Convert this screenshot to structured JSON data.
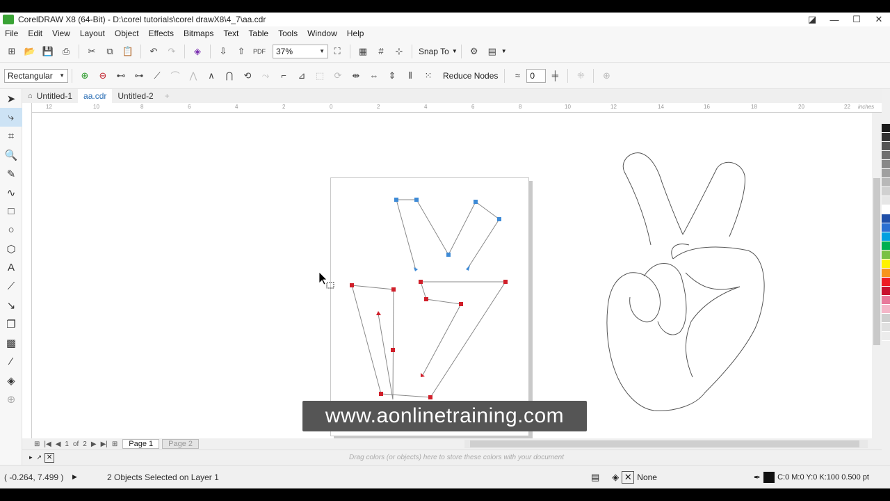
{
  "window": {
    "title": "CorelDRAW X8 (64-Bit) - D:\\corel tutorials\\corel drawX8\\4_7\\aa.cdr",
    "controls": [
      "◪",
      "—",
      "☐",
      "✕"
    ]
  },
  "menu": [
    "File",
    "Edit",
    "View",
    "Layout",
    "Object",
    "Effects",
    "Bitmaps",
    "Text",
    "Table",
    "Tools",
    "Window",
    "Help"
  ],
  "standard_toolbar": {
    "zoom_value": "37%",
    "snap_label": "Snap To"
  },
  "property_bar": {
    "selection_mode": "Rectangular",
    "reduce_nodes_label": "Reduce Nodes",
    "curve_smoothness": "0"
  },
  "doc_tabs": [
    "Untitled-1",
    "aa.cdr",
    "Untitled-2"
  ],
  "rulers": {
    "units": "inches",
    "h_ticks": [
      "12",
      "10",
      "8",
      "6",
      "4",
      "2",
      "0",
      "2",
      "4",
      "6",
      "8",
      "10",
      "12",
      "14",
      "16",
      "18",
      "20",
      "22"
    ]
  },
  "canvas": {
    "watermark": "www.aonlinetraining.com"
  },
  "pages": {
    "current": "1",
    "of": "of",
    "total": "2",
    "tabs": [
      "Page 1",
      "Page 2"
    ]
  },
  "color_dock_hint": "Drag colors (or objects) here to store these colors with your document",
  "status": {
    "coords": "( -0.264, 7.499 )",
    "selection": "2 Objects Selected on Layer 1",
    "fill_label": "None",
    "outline_label": "C:0 M:0 Y:0 K:100  0.500 pt"
  },
  "palette_colors": [
    "#1a1a1a",
    "#333333",
    "#555555",
    "#6f6f6f",
    "#888888",
    "#a0a0a0",
    "#b8b8b8",
    "#d0d0d0",
    "#e6e6e6",
    "#ffffff",
    "#1f4fa8",
    "#2b6fd1",
    "#00a0e0",
    "#00b050",
    "#7ac143",
    "#fff200",
    "#f7941d",
    "#ed1c24",
    "#c8102e",
    "#e8799b",
    "#f4b6c8",
    "#cfcfcf",
    "#e0e0e0",
    "#ececec"
  ],
  "colors": {
    "selected_node_blue": "#3d8ad6",
    "selected_node_red": "#d01f2a",
    "accent": "#2a6eb5"
  }
}
